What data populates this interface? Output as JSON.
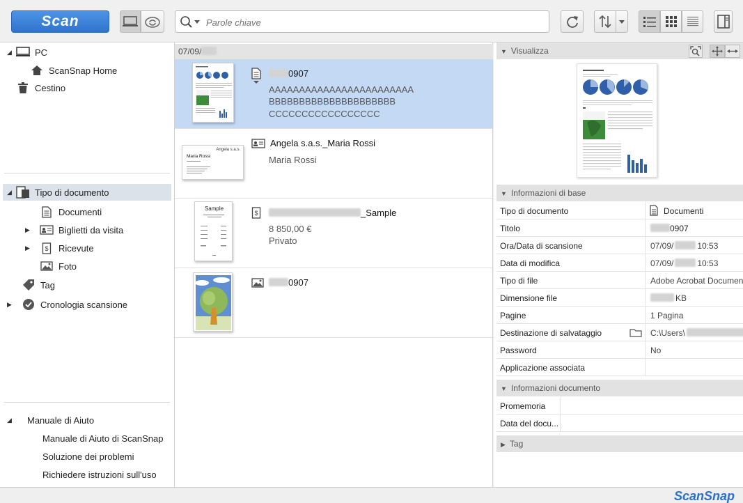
{
  "toolbar": {
    "scan_label": "Scan",
    "search_placeholder": "Parole chiave"
  },
  "tree": {
    "pc": "PC",
    "scansnap_home": "ScanSnap Home",
    "trash": "Cestino",
    "doc_type": "Tipo di documento",
    "documents": "Documenti",
    "business_cards": "Biglietti da visita",
    "receipts": "Ricevute",
    "photos": "Foto",
    "tag": "Tag",
    "scan_history": "Cronologia scansione"
  },
  "help": {
    "title": "Manuale di Aiuto",
    "items": [
      "Manuale di Aiuto di ScanSnap",
      "Soluzione dei problemi",
      "Richiedere istruzioni sull'uso"
    ]
  },
  "list": {
    "date_header": "07/09/",
    "items": [
      {
        "title_suffix": "0907",
        "lines": [
          "AAAAAAAAAAAAAAAAAAAAAAAA",
          "BBBBBBBBBBBBBBBBBBBBB",
          "CCCCCCCCCCCCCCCCC"
        ]
      },
      {
        "title": "Angela s.a.s._Maria Rossi",
        "lines": [
          "Maria Rossi"
        ],
        "thumb_company": "Angela s.a.s.",
        "thumb_name": "Maria Rossi"
      },
      {
        "title_suffix": "_Sample",
        "lines": [
          "8 850,00 €",
          "Privato"
        ],
        "thumb_title": "Sample"
      },
      {
        "title_suffix": "0907",
        "lines": []
      }
    ]
  },
  "preview": {
    "title": "Visualizza"
  },
  "basic_info": {
    "title": "Informazioni di base",
    "rows": [
      {
        "key": "Tipo di documento",
        "value": "Documenti"
      },
      {
        "key": "Titolo",
        "value": "0907"
      },
      {
        "key": "Ora/Data di scansione",
        "value_a": "07/09/",
        "value_b": "10:53"
      },
      {
        "key": "Data di modifica",
        "value_a": "07/09/",
        "value_b": "10:53"
      },
      {
        "key": "Tipo di file",
        "value": "Adobe Acrobat Document"
      },
      {
        "key": "Dimensione file",
        "value": "KB"
      },
      {
        "key": "Pagine",
        "value": "1 Pagina"
      },
      {
        "key": "Destinazione di salvataggio",
        "value": "C:\\Users\\"
      },
      {
        "key": "Password",
        "value": "No"
      },
      {
        "key": "Applicazione associata",
        "value": ""
      }
    ]
  },
  "doc_info": {
    "title": "Informazioni documento",
    "rows": [
      {
        "key": "Promemoria",
        "value": ""
      },
      {
        "key": "Data del docu...",
        "value": ""
      }
    ]
  },
  "tag_section": {
    "title": "Tag"
  },
  "brand": "ScanSnap",
  "colors": {
    "accent": "#2f74cc",
    "selection": "#c4daf4"
  }
}
